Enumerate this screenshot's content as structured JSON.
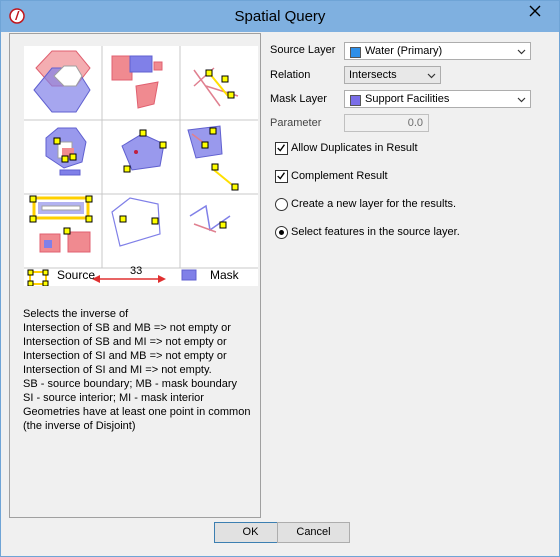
{
  "window": {
    "title": "Spatial Query"
  },
  "form": {
    "source_layer_label": "Source Layer",
    "source_layer_value": "Water (Primary)",
    "relation_label": "Relation",
    "relation_value": "Intersects",
    "mask_layer_label": "Mask Layer",
    "mask_layer_value": "Support Facilities",
    "parameter_label": "Parameter",
    "parameter_value": "0.0",
    "allow_duplicates_label": "Allow Duplicates in Result",
    "allow_duplicates_checked": true,
    "complement_label": "Complement Result",
    "complement_checked": true,
    "radio_new_layer_label": "Create a new layer for the results.",
    "radio_select_label": "Select features in the source layer.",
    "selected_radio": "select"
  },
  "diagram": {
    "source_label": "Source",
    "mask_label": "Mask",
    "distance_label": "33"
  },
  "description": "Selects the inverse of\nIntersection of SB and MB => not empty or\nIntersection of SB and MI => not empty or\nIntersection of SI and MB => not empty or\nIntersection of SI and MI => not empty.\nSB - source boundary; MB - mask boundary\nSI - source interior; MI - mask interior\nGeometries have at least one point in common\n(the inverse of Disjoint)",
  "buttons": {
    "ok": "OK",
    "cancel": "Cancel"
  },
  "colors": {
    "titlebar": "#7fb0e0",
    "source_swatch": "#2e8fe8",
    "mask_swatch": "#7a6ee8",
    "source_fill": "#f08a90",
    "mask_fill": "#8080e8",
    "vertex": "#ffff00"
  },
  "icons": {
    "app": "app-logo-icon",
    "close": "close-icon",
    "dropdown": "chevron-down-icon"
  }
}
